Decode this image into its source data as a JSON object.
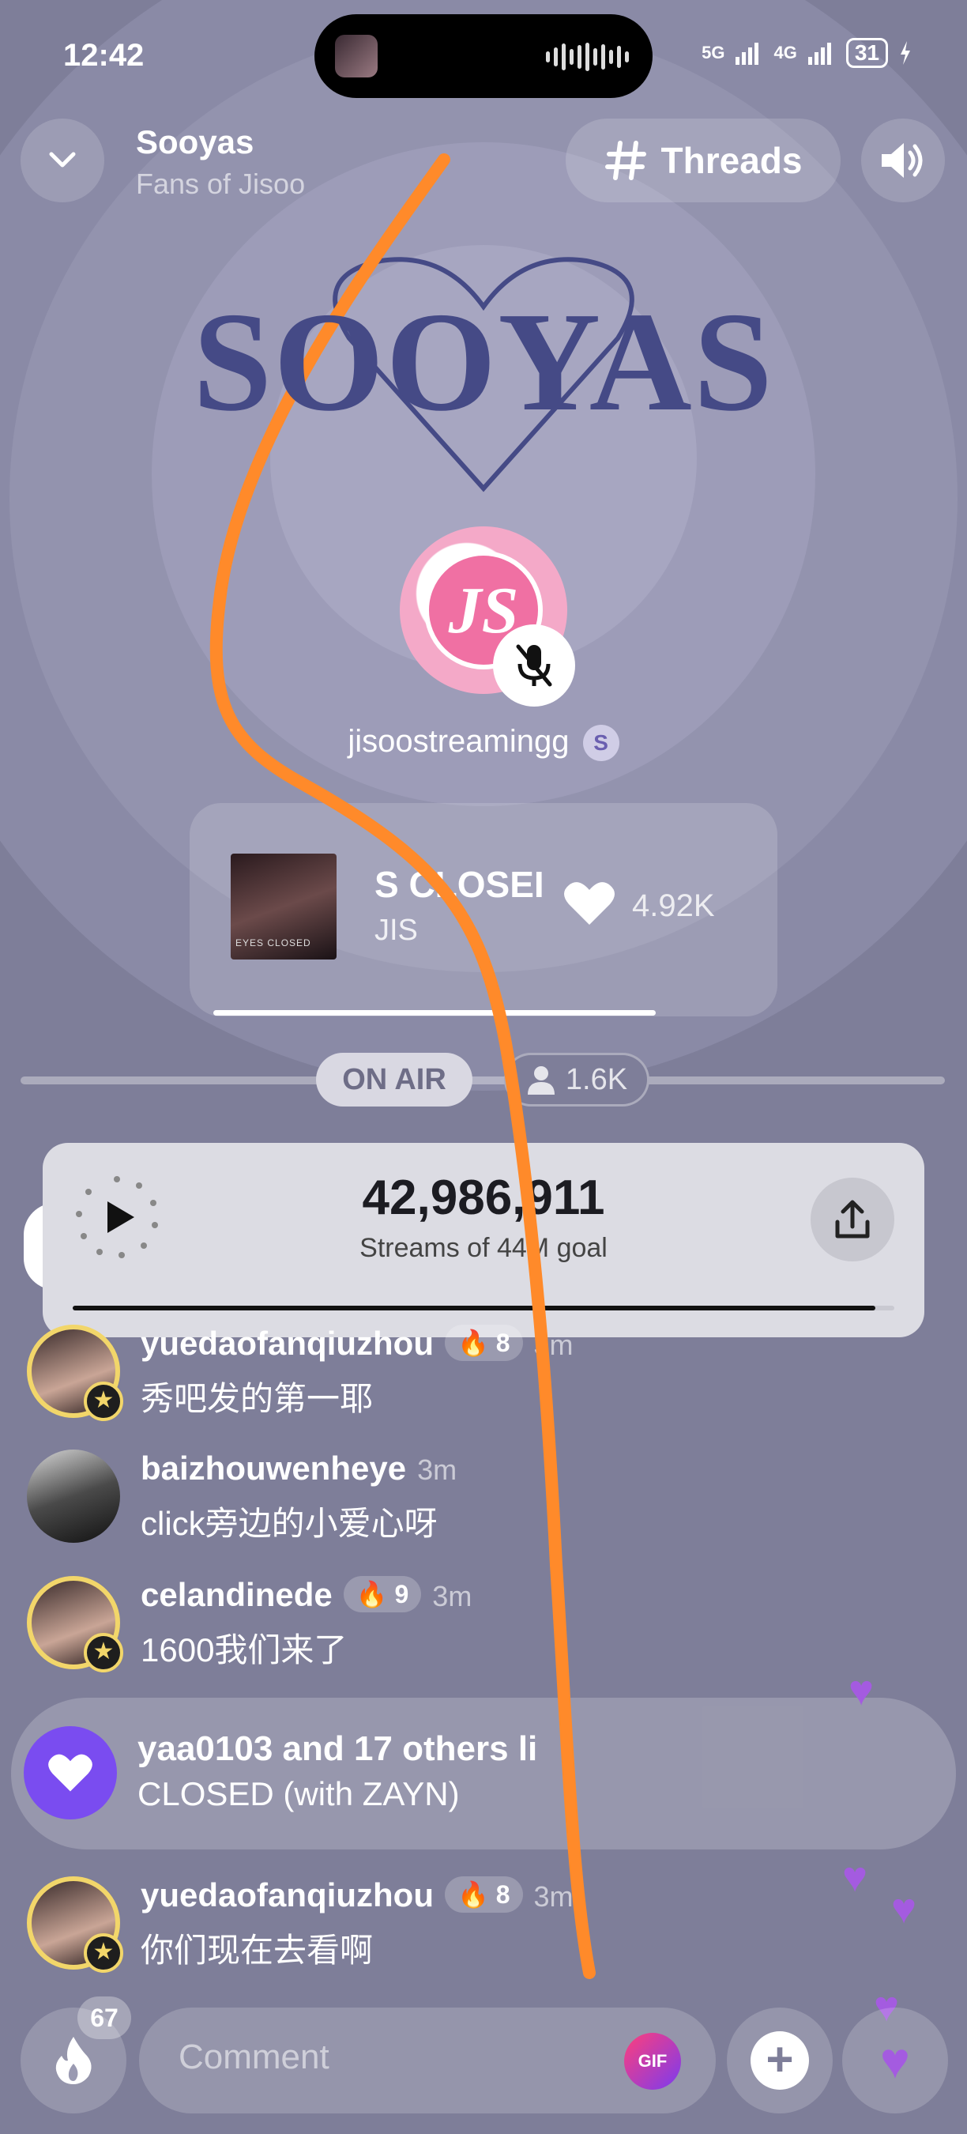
{
  "status_bar": {
    "time": "12:42",
    "network_1": "5G",
    "network_2": "4G",
    "battery": "31"
  },
  "header": {
    "title": "Sooyas",
    "subtitle": "Fans of Jisoo",
    "threads_label": "Threads"
  },
  "logo": {
    "text": "SOOYAS"
  },
  "host": {
    "name": "jisoostreamingg",
    "avatar_letters": "JS",
    "badge": "S"
  },
  "now_playing": {
    "title": "S CLOSEI",
    "artist": "JIS",
    "likes": "4.92K",
    "cover_text": "EYES CLOSED"
  },
  "room": {
    "on_air_label": "ON AIR",
    "listeners": "1.6K"
  },
  "streams": {
    "count": "42,986,911",
    "subtitle": "Streams of 44M goal",
    "progress_fraction": 0.977
  },
  "chat": [
    {
      "name": "yuedaofanqiuzhou",
      "fire": "8",
      "time": "3m",
      "message": "秀吧发的第一耶",
      "gold": true
    },
    {
      "name": "baizhouwenheye",
      "fire": "",
      "time": "3m",
      "message": "click旁边的小爱心呀",
      "gold": false
    },
    {
      "name": "celandinede",
      "fire": "9",
      "time": "3m",
      "message": "1600我们来了",
      "gold": true
    },
    {
      "name": "yuedaofanqiuzhou",
      "fire": "8",
      "time": "3m",
      "message": "你们现在去看啊",
      "gold": true
    }
  ],
  "like_event": {
    "title": "yaa0103 and 17 others li",
    "subtitle": "CLOSED (with ZAYN)"
  },
  "bottom_bar": {
    "fire_count": "67",
    "comment_placeholder": "Comment",
    "gif_label": "GIF",
    "plus_label": "+"
  },
  "colors": {
    "background": "#7e7e99",
    "accent_purple": "#7a4cf0",
    "logo_navy": "#454a86",
    "annotation_orange": "#ff8a2a",
    "gold": "#f2d66a"
  },
  "icons": [
    "chevron-down-icon",
    "hash-icon",
    "speaker-icon",
    "mic-off-icon",
    "heart-icon",
    "person-icon",
    "play-icon",
    "share-icon",
    "fire-icon",
    "gif-icon",
    "plus-icon",
    "purple-heart-icon"
  ]
}
